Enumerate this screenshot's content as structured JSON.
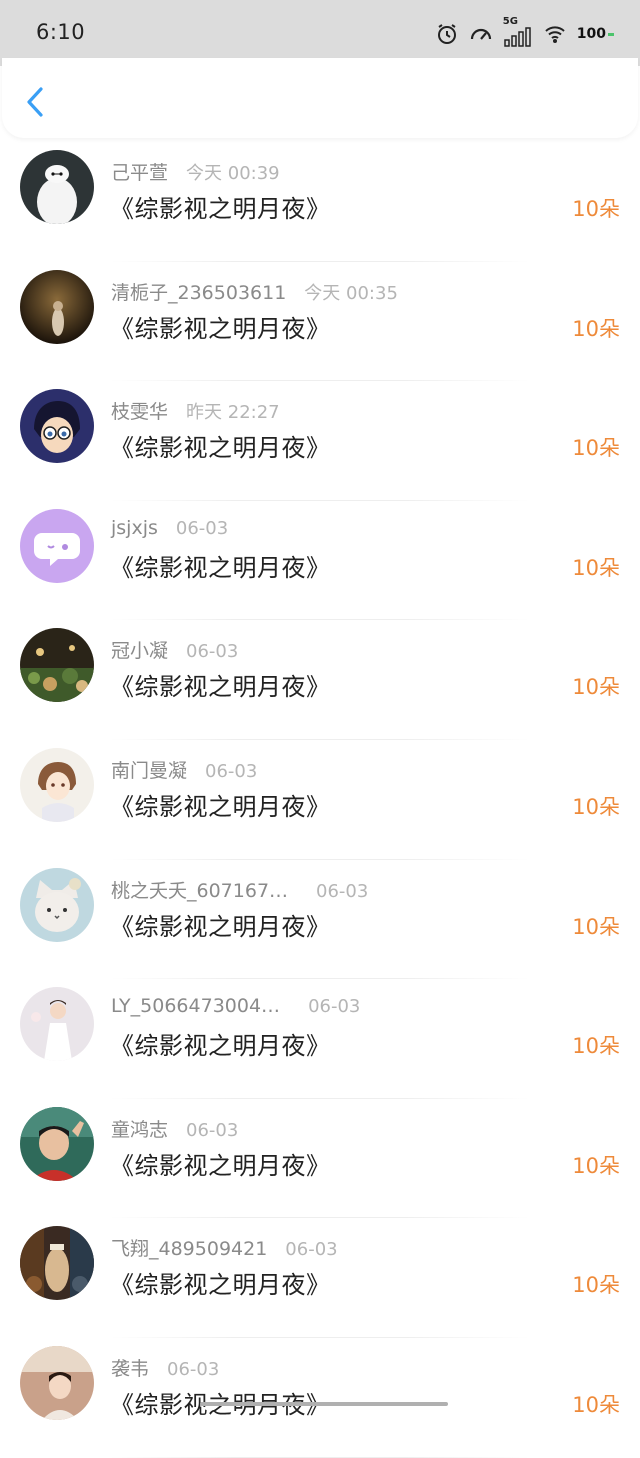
{
  "status_bar": {
    "time": "6:10",
    "network": "5G",
    "battery": "100"
  },
  "gifts_list": [
    {
      "username": "己平萱",
      "time": "今天 00:39",
      "book": "《综影视之明月夜》",
      "gift": "10朵",
      "avatar_color": "#2d3436",
      "avatar_icon": "baymax-icon"
    },
    {
      "username": "清栀子_236503611",
      "time": "今天 00:35",
      "book": "《综影视之明月夜》",
      "gift": "10朵",
      "avatar_color": "#3e2c1c",
      "avatar_icon": "night-photo-icon"
    },
    {
      "username": "枝雯华",
      "time": "昨天 22:27",
      "book": "《综影视之明月夜》",
      "gift": "10朵",
      "avatar_color": "#2c2f6b",
      "avatar_icon": "anime-detective-icon"
    },
    {
      "username": "jsjxjs",
      "time": "06-03",
      "book": "《综影视之明月夜》",
      "gift": "10朵",
      "avatar_color": "#c9a6f0",
      "avatar_icon": "chat-bubble-icon"
    },
    {
      "username": "冠小凝",
      "time": "06-03",
      "book": "《综影视之明月夜》",
      "gift": "10朵",
      "avatar_color": "#3a4a2a",
      "avatar_icon": "garden-icon"
    },
    {
      "username": "南门曼凝",
      "time": "06-03",
      "book": "《综影视之明月夜》",
      "gift": "10朵",
      "avatar_color": "#f3f0ea",
      "avatar_icon": "anime-girl-icon"
    },
    {
      "username": "桃之夭夭_607167…",
      "time": "06-03",
      "book": "《综影视之明月夜》",
      "gift": "10朵",
      "avatar_color": "#bfd8e0",
      "avatar_icon": "cat-icon"
    },
    {
      "username": "LY_5066473004…",
      "time": "06-03",
      "book": "《综影视之明月夜》",
      "gift": "10朵",
      "avatar_color": "#eae5ea",
      "avatar_icon": "child-photo-icon"
    },
    {
      "username": "童鸿志",
      "time": "06-03",
      "book": "《综影视之明月夜》",
      "gift": "10朵",
      "avatar_color": "#2f6a5a",
      "avatar_icon": "boy-photo-icon"
    },
    {
      "username": "飞翔_489509421",
      "time": "06-03",
      "book": "《综影视之明月夜》",
      "gift": "10朵",
      "avatar_color": "#3a2a22",
      "avatar_icon": "poster-icon"
    },
    {
      "username": "袭韦",
      "time": "06-03",
      "book": "《综影视之明月夜》",
      "gift": "10朵",
      "avatar_color": "#c9a18a",
      "avatar_icon": "person-photo-icon"
    }
  ],
  "colors": {
    "accent": "#3a9ff5",
    "gift": "#ee8a3a",
    "username": "#8a8a8a",
    "time": "#b5b5b5",
    "status_bg": "#dcdcdc"
  }
}
